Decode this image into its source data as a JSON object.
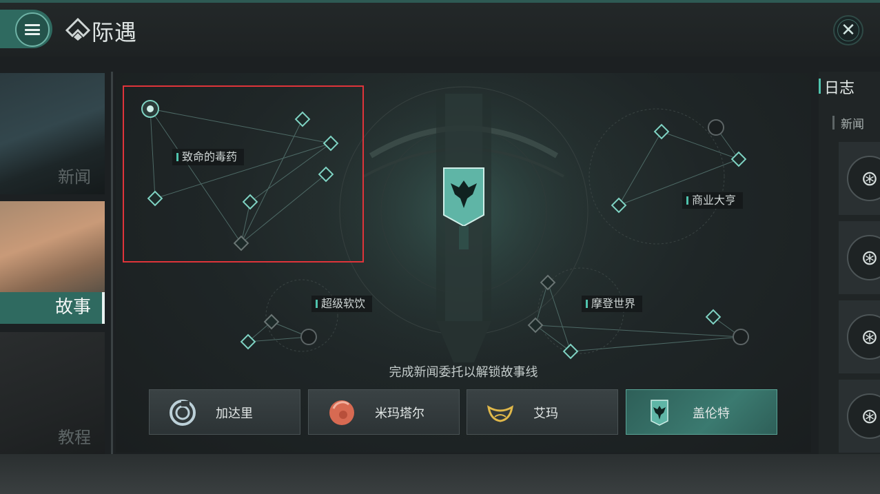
{
  "header": {
    "title": "际遇",
    "menu_icon": "hamburger-menu-icon",
    "close_icon": "close-icon",
    "close_glyph": "✕"
  },
  "left_tabs": [
    {
      "label": "新闻"
    },
    {
      "label": "故事",
      "active": true
    },
    {
      "label": "教程"
    }
  ],
  "map": {
    "storylines": [
      {
        "label": "致命的毒药"
      },
      {
        "label": "商业大亨"
      },
      {
        "label": "超级软饮"
      },
      {
        "label": "摩登世界"
      }
    ],
    "hint": "完成新闻委托以解锁故事线",
    "emblem_icon": "eagle-banner-icon"
  },
  "characters": [
    {
      "name": "加达里",
      "icon": "caldari-emblem-icon"
    },
    {
      "name": "米玛塔尔",
      "icon": "minmatar-emblem-icon"
    },
    {
      "name": "艾玛",
      "icon": "amarr-emblem-icon"
    },
    {
      "name": "盖伦特",
      "icon": "gallente-emblem-icon",
      "active": true
    }
  ],
  "log": {
    "title": "日志",
    "subtitle": "新闻",
    "entry_icon": "target-icon",
    "entry_glyph": "⊛"
  },
  "colors": {
    "accent": "#4fc3ad",
    "active_tab": "#2f6a60",
    "highlight_box": "#e0343a"
  }
}
